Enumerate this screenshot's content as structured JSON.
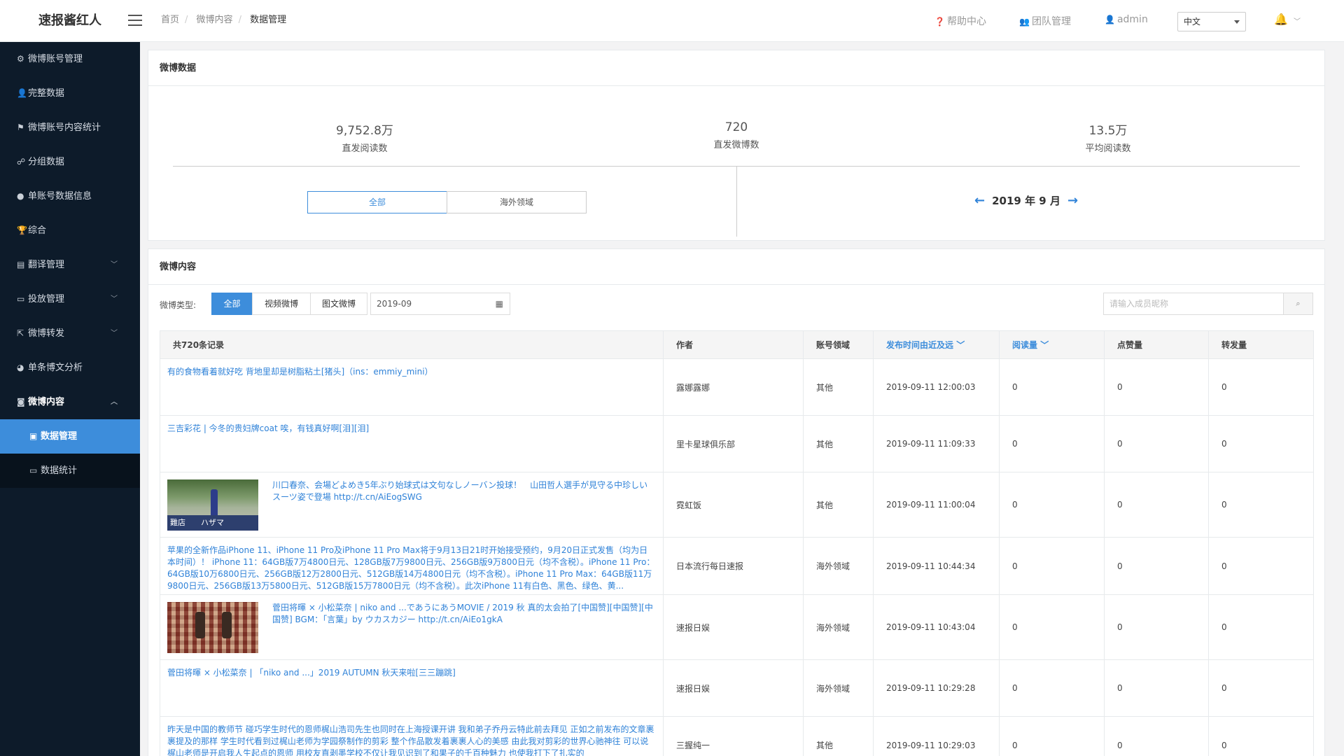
{
  "app": {
    "brand": "速报酱红人"
  },
  "breadcrumb": [
    "首页",
    "微博内容",
    "数据管理"
  ],
  "topnav": {
    "help": "帮助中心",
    "team": "团队管理",
    "user": "admin",
    "language": "中文"
  },
  "sidebar": {
    "items": [
      {
        "label": "微博账号管理",
        "icon": "gear-icon"
      },
      {
        "label": "完整数据",
        "icon": "user-icon"
      },
      {
        "label": "微博账号内容统计",
        "icon": "flag-icon"
      },
      {
        "label": "分组数据",
        "icon": "sitemap-icon"
      },
      {
        "label": "单账号数据信息",
        "icon": "chat-icon"
      },
      {
        "label": "综合",
        "icon": "trophy-icon"
      },
      {
        "label": "翻译管理",
        "icon": "doc-icon"
      },
      {
        "label": "投放管理",
        "icon": "folder-icon"
      },
      {
        "label": "微博转发",
        "icon": "share-icon"
      },
      {
        "label": "单条博文分析",
        "icon": "pie-icon"
      },
      {
        "label": "微博内容",
        "icon": "weibo-icon"
      },
      {
        "label": "数据管理",
        "icon": "image-icon"
      },
      {
        "label": "数据统计",
        "icon": "folder-icon"
      }
    ]
  },
  "summary": {
    "title": "微博数据",
    "stats": [
      {
        "value": "9,752.8万",
        "label": "直发阅读数"
      },
      {
        "value": "720",
        "label": "直发微博数"
      },
      {
        "value": "13.5万",
        "label": "平均阅读数"
      }
    ],
    "segments": [
      "全部",
      "海外领域"
    ],
    "month": "2019 年 9 月"
  },
  "content": {
    "title": "微博内容",
    "filter_label": "微博类型:",
    "types": [
      "全部",
      "视频微博",
      "图文微博"
    ],
    "date": "2019-09",
    "search_placeholder": "请输入成员昵称",
    "columns": [
      "共720条记录",
      "作者",
      "账号领域",
      "发布时间由近及远",
      "阅读量",
      "点赞量",
      "转发量"
    ],
    "rows": [
      {
        "text": "有的食物看着就好吃 背地里却是树脂粘土[猪头]（ins：emmiy_mini）",
        "author": "露娜露娜",
        "domain": "其他",
        "time": "2019-09-11 12:00:03",
        "reads": "0",
        "likes": "0",
        "forwards": "0"
      },
      {
        "text": "三吉彩花 | 今冬的贵妇牌coat 唉，有钱真好啊[泪][泪]",
        "author": "里卡星球俱乐部",
        "domain": "其他",
        "time": "2019-09-11 11:09:33",
        "reads": "0",
        "likes": "0",
        "forwards": "0"
      },
      {
        "text": "川口春奈、会場どよめき5年ぶり始球式は文句なしノーバン投球！　山田哲人選手が見守る中珍しいスーツ姿で登場 http://t.cn/AiEogSWG",
        "author": "霓虹饭",
        "domain": "其他",
        "time": "2019-09-11 11:00:04",
        "reads": "0",
        "likes": "0",
        "forwards": "0",
        "thumb_caption": "難店　　ハザマ"
      },
      {
        "text": "苹果的全新作品iPhone 11、iPhone 11 Pro及iPhone 11 Pro Max将于9月13日21时开始接受预约，9月20日正式发售（均为日本时间）！ iPhone 11：64GB版7万4800日元、128GB版7万9800日元、256GB版9万800日元（均不含税）。iPhone 11 Pro：64GB版10万6800日元、256GB版12万2800日元、512GB版14万4800日元（均不含税）。iPhone 11 Pro Max：64GB版11万9800日元、256GB版13万5800日元、512GB版15万7800日元（均不含税）。此次iPhone 11有白色、黑色、绿色、黄...",
        "author": "日本流行每日速报",
        "domain": "海外领域",
        "time": "2019-09-11 10:44:34",
        "reads": "0",
        "likes": "0",
        "forwards": "0"
      },
      {
        "text": "菅田将暉 × 小松菜奈 | niko and ...であうにあうMOVIE / 2019 秋 真的太会拍了[中国赞][中国赞][中国赞] BGM：「言葉」by ウカスカジー http://t.cn/AiEo1gkA",
        "author": "速报日娱",
        "domain": "海外领域",
        "time": "2019-09-11 10:43:04",
        "reads": "0",
        "likes": "0",
        "forwards": "0"
      },
      {
        "text": "菅田将暉 × 小松菜奈 | 「niko and ...」2019 AUTUMN 秋天来啦[三三蹦跳]",
        "author": "速报日娱",
        "domain": "海外领域",
        "time": "2019-09-11 10:29:28",
        "reads": "0",
        "likes": "0",
        "forwards": "0"
      },
      {
        "text": "昨天是中国的教师节 碰巧学生时代的恩师梶山浩司先生也同时在上海授课开讲 我和弟子乔丹云特此前去拜见 正如之前发布的文章裹裹提及的那样 学生时代看到过梶山老师为学园祭制作的剪彩 整个作品散发着裹裹人心的美感 由此我对剪彩的世界心驰神往 可以说梶山老师是开启我人生起点的恩师 用校友直剥墨学校不仅让我见识到了和果子的千百种魅力 也使我打下了扎实的",
        "author": "三握纯一",
        "domain": "其他",
        "time": "2019-09-11 10:29:03",
        "reads": "0",
        "likes": "0",
        "forwards": "0"
      }
    ]
  }
}
